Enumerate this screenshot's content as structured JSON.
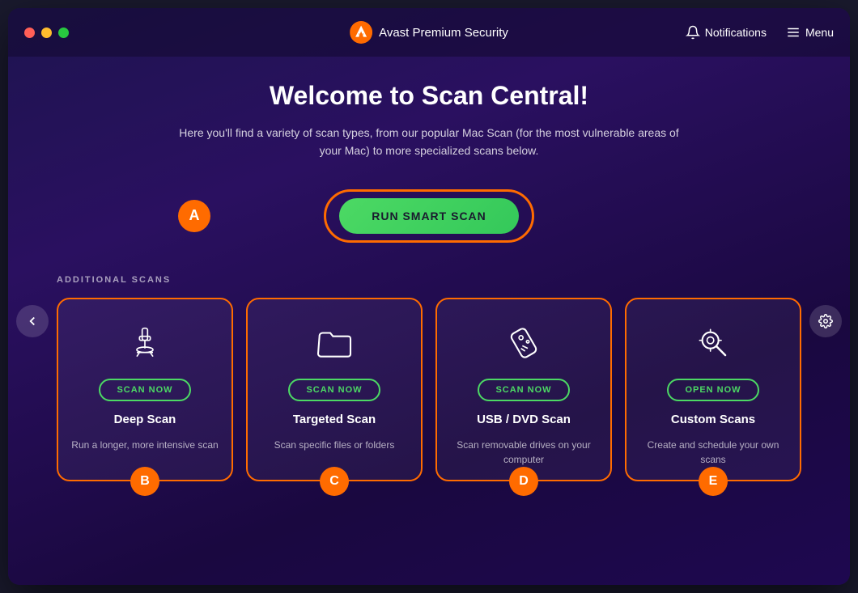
{
  "window": {
    "title": "Avast Premium Security",
    "logo_alt": "Avast logo"
  },
  "titlebar": {
    "app_name": "Avast Premium Security",
    "notifications_label": "Notifications",
    "menu_label": "Menu"
  },
  "main": {
    "page_title": "Welcome to Scan Central!",
    "page_subtitle": "Here you'll find a variety of scan types, from our popular Mac Scan (for the most vulnerable areas of your Mac) to more specialized scans below.",
    "smart_scan": {
      "badge": "A",
      "button_label": "RUN SMART SCAN"
    },
    "additional_scans_label": "ADDITIONAL SCANS",
    "scan_cards": [
      {
        "id": "deep-scan",
        "badge": "B",
        "button_label": "SCAN NOW",
        "title": "Deep Scan",
        "description": "Run a longer, more intensive scan",
        "icon": "microscope"
      },
      {
        "id": "targeted-scan",
        "badge": "C",
        "button_label": "SCAN NOW",
        "title": "Targeted Scan",
        "description": "Scan specific files or folders",
        "icon": "folder"
      },
      {
        "id": "usb-dvd-scan",
        "badge": "D",
        "button_label": "SCAN NOW",
        "title": "USB / DVD Scan",
        "description": "Scan removable drives on your computer",
        "icon": "usb"
      },
      {
        "id": "custom-scans",
        "badge": "E",
        "button_label": "OPEN NOW",
        "title": "Custom Scans",
        "description": "Create and schedule your own scans",
        "icon": "settings-search"
      }
    ]
  },
  "colors": {
    "orange": "#ff6b00",
    "green": "#4cd964",
    "white": "#ffffff"
  }
}
